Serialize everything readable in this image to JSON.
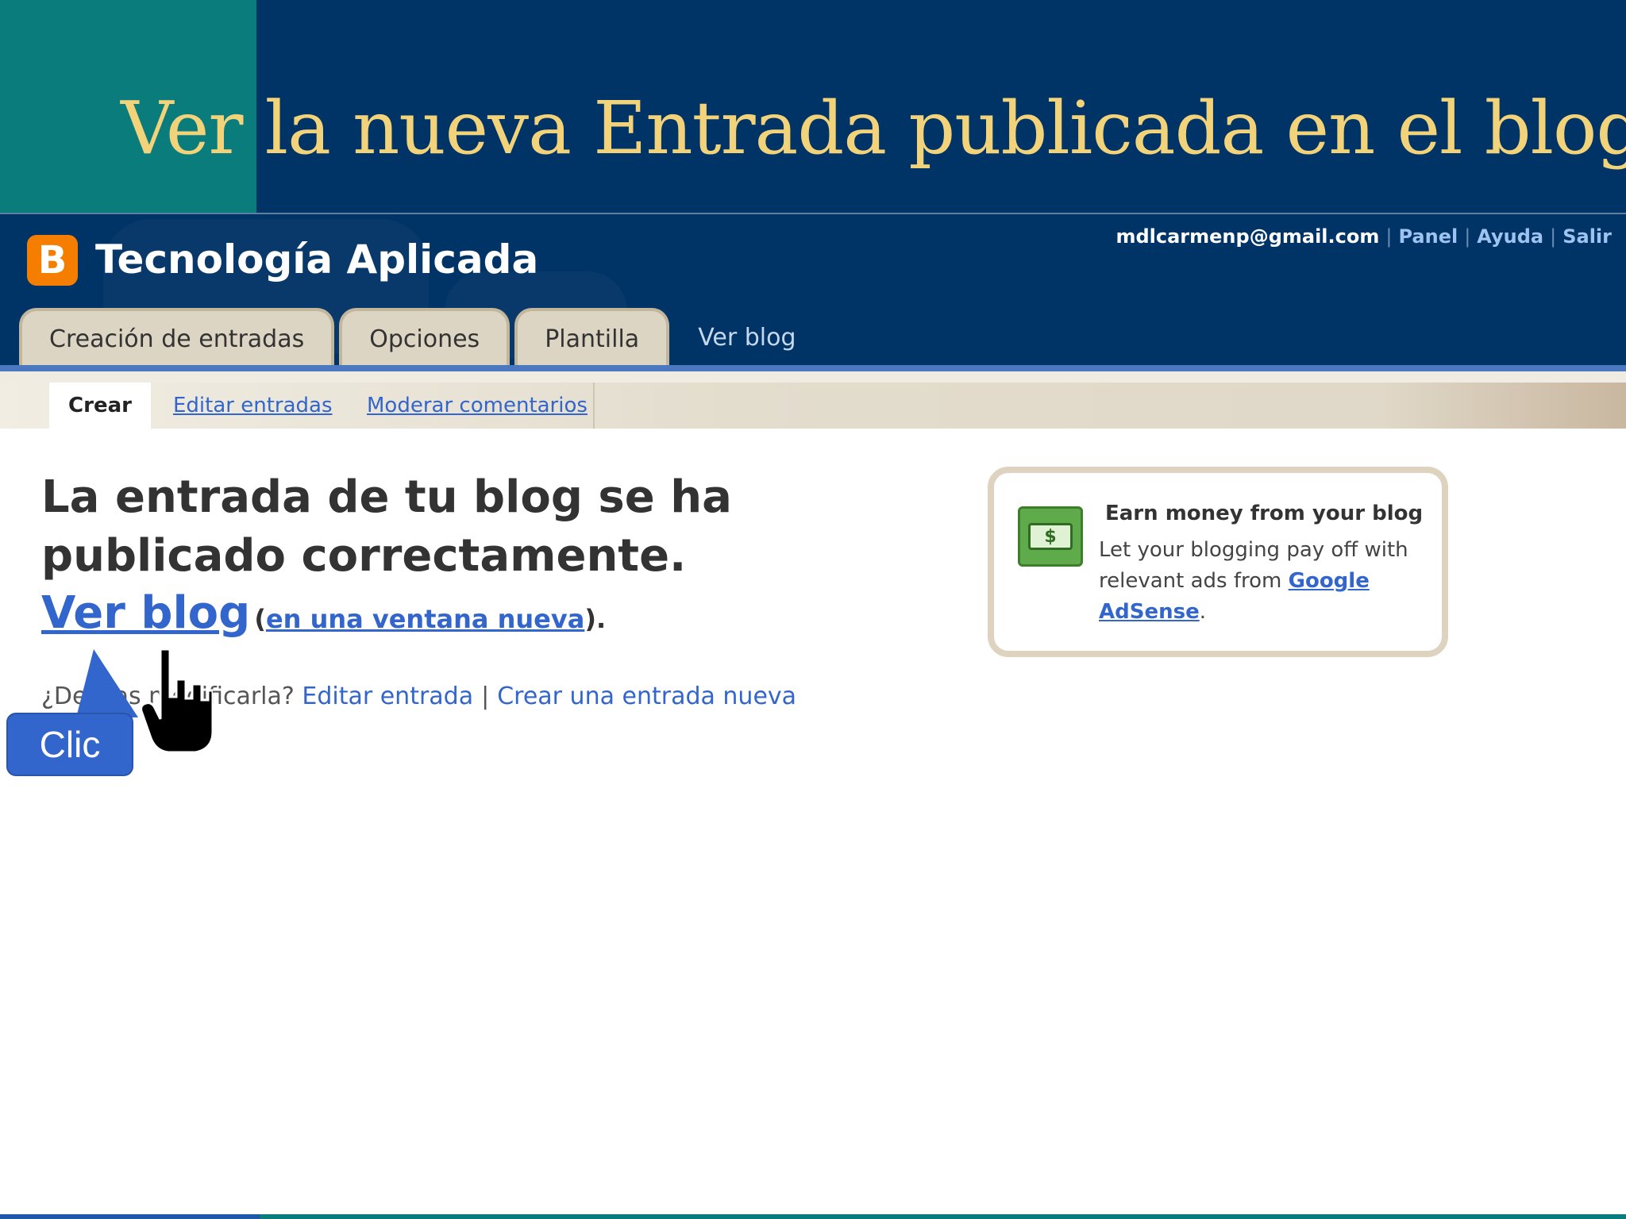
{
  "slide": {
    "title": "Ver la nueva Entrada publicada en el blog"
  },
  "blogger": {
    "logo_letter": "B",
    "blog_title": "Tecnología Aplicada",
    "top_links": {
      "email": "mdlcarmenp@gmail.com",
      "panel": "Panel",
      "help": "Ayuda",
      "logout": "Salir"
    },
    "tabs": [
      {
        "label": "Creación de entradas"
      },
      {
        "label": "Opciones"
      },
      {
        "label": "Plantilla"
      }
    ],
    "view_blog_tab": "Ver blog",
    "subtabs": {
      "create": "Crear",
      "edit": "Editar entradas",
      "moderate": "Moderar comentarios"
    }
  },
  "main": {
    "success_message": "La entrada de tu blog se ha publicado correctamente.",
    "view_blog_link": "Ver blog",
    "paren_open": "(",
    "new_window_link": "en una ventana nueva",
    "paren_close": ").",
    "modify_prompt": "¿Deseas modificarla?",
    "edit_post_link": "Editar entrada",
    "separator": "|",
    "new_post_link": "Crear una entrada nueva"
  },
  "adsense": {
    "icon_symbol": "$",
    "title": "Earn money from your blog",
    "body": "Let your blogging pay off with relevant ads from",
    "link": "Google AdSense",
    "period": "."
  },
  "callout": {
    "label": "Clic"
  },
  "icons": {
    "logo": "blogger-logo-icon",
    "money": "money-icon",
    "cursor": "hand-cursor-icon"
  },
  "colors": {
    "header_bg": "#003366",
    "teal": "#0b7c7c",
    "title_gold": "#f3d37a",
    "link_blue": "#3366cc",
    "blogger_orange": "#f57d00",
    "callout_blue": "#3366cc"
  }
}
